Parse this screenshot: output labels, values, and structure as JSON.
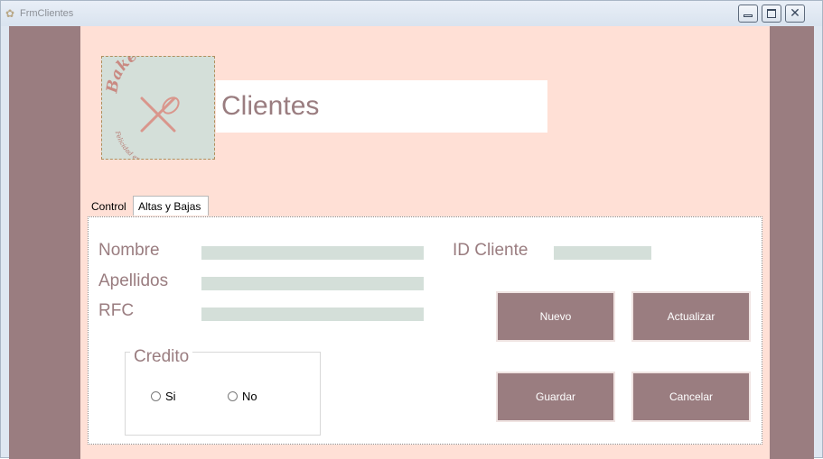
{
  "window": {
    "title": "FrmClientes"
  },
  "header": {
    "title": "Clientes",
    "logo": {
      "brand": "Bake Off",
      "tagline": "Felicidad en un trozo"
    }
  },
  "tabs": [
    {
      "label": "Control",
      "selected": false
    },
    {
      "label": "Altas y Bajas",
      "selected": true
    }
  ],
  "form": {
    "nombre_label": "Nombre",
    "nombre_value": "",
    "apellidos_label": "Apellidos",
    "apellidos_value": "",
    "rfc_label": "RFC",
    "rfc_value": "",
    "id_cliente_label": "ID Cliente",
    "id_cliente_value": ""
  },
  "credito": {
    "title": "Credito",
    "options": [
      {
        "label": "Si",
        "checked": false
      },
      {
        "label": "No",
        "checked": false
      }
    ]
  },
  "buttons": {
    "nuevo": "Nuevo",
    "actualizar": "Actualizar",
    "guardar": "Guardar",
    "cancelar": "Cancelar"
  },
  "colors": {
    "accent": "#9a7d80",
    "background": "#ffe0d6",
    "field_fill": "#d4dfd9",
    "logo_text": "#c98a82"
  },
  "icons": {
    "app": "app-icon",
    "minimize": "minimize-icon",
    "maximize": "maximize-icon",
    "close": "close-icon",
    "logo": "rolling-pin-whisk-logo"
  }
}
